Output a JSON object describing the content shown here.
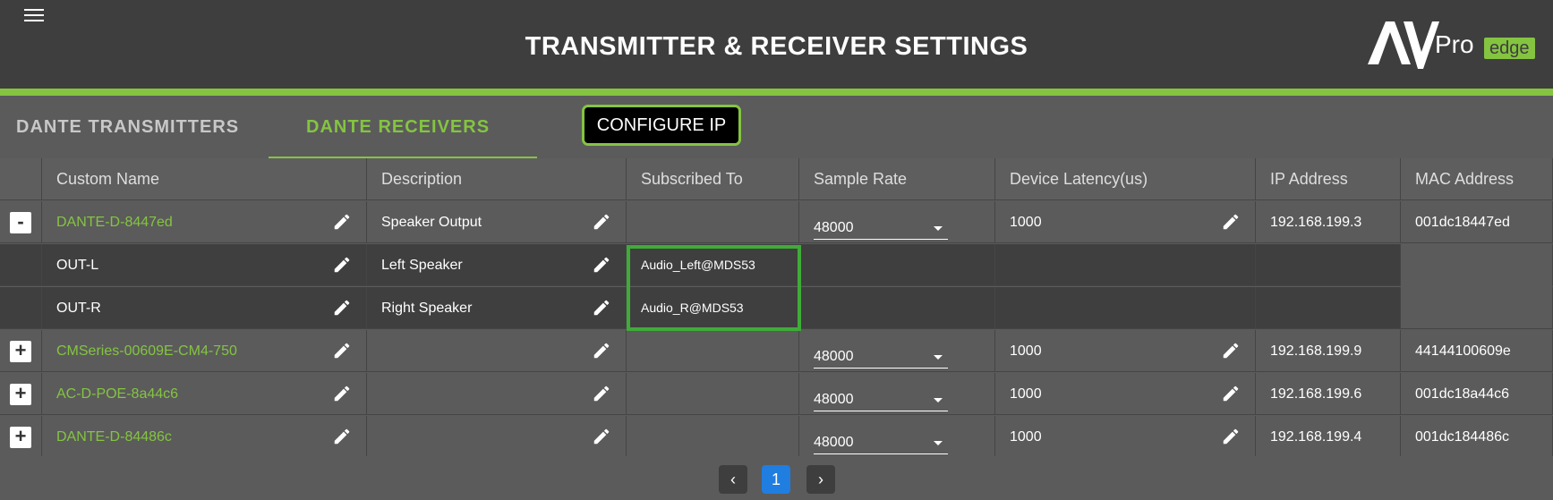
{
  "header": {
    "title": "TRANSMITTER & RECEIVER SETTINGS",
    "logo": {
      "av": "AV",
      "pro": "Pro",
      "edge": "edge"
    },
    "accent": "#84c441"
  },
  "tabs": [
    {
      "label": "DANTE TRANSMITTERS",
      "active": false
    },
    {
      "label": "DANTE RECEIVERS",
      "active": true
    }
  ],
  "configure_button": "CONFIGURE IP",
  "table": {
    "columns": [
      "Custom Name",
      "Description",
      "Subscribed To",
      "Sample Rate",
      "Device Latency(us)",
      "IP Address",
      "MAC Address"
    ],
    "devices": [
      {
        "expander": "-",
        "name": "DANTE-D-8447ed",
        "description": "Speaker Output",
        "subscribed": "",
        "sample_rate": "48000",
        "latency": "1000",
        "ip": "192.168.199.3",
        "mac": "001dc18447ed",
        "channels": [
          {
            "name": "OUT-L",
            "description": "Left Speaker",
            "subscribed": "Audio_Left@MDS53"
          },
          {
            "name": "OUT-R",
            "description": "Right Speaker",
            "subscribed": "Audio_R@MDS53"
          }
        ]
      },
      {
        "expander": "+",
        "name": "CMSeries-00609E-CM4-750",
        "description": "",
        "subscribed": "",
        "sample_rate": "48000",
        "latency": "1000",
        "ip": "192.168.199.9",
        "mac": "44144100609e"
      },
      {
        "expander": "+",
        "name": "AC-D-POE-8a44c6",
        "description": "",
        "subscribed": "",
        "sample_rate": "48000",
        "latency": "1000",
        "ip": "192.168.199.6",
        "mac": "001dc18a44c6"
      },
      {
        "expander": "+",
        "name": "DANTE-D-84486c",
        "description": "",
        "subscribed": "",
        "sample_rate": "48000",
        "latency": "1000",
        "ip": "192.168.199.4",
        "mac": "001dc184486c"
      }
    ]
  },
  "pagination": {
    "prev": "‹",
    "current": "1",
    "next": "›"
  }
}
